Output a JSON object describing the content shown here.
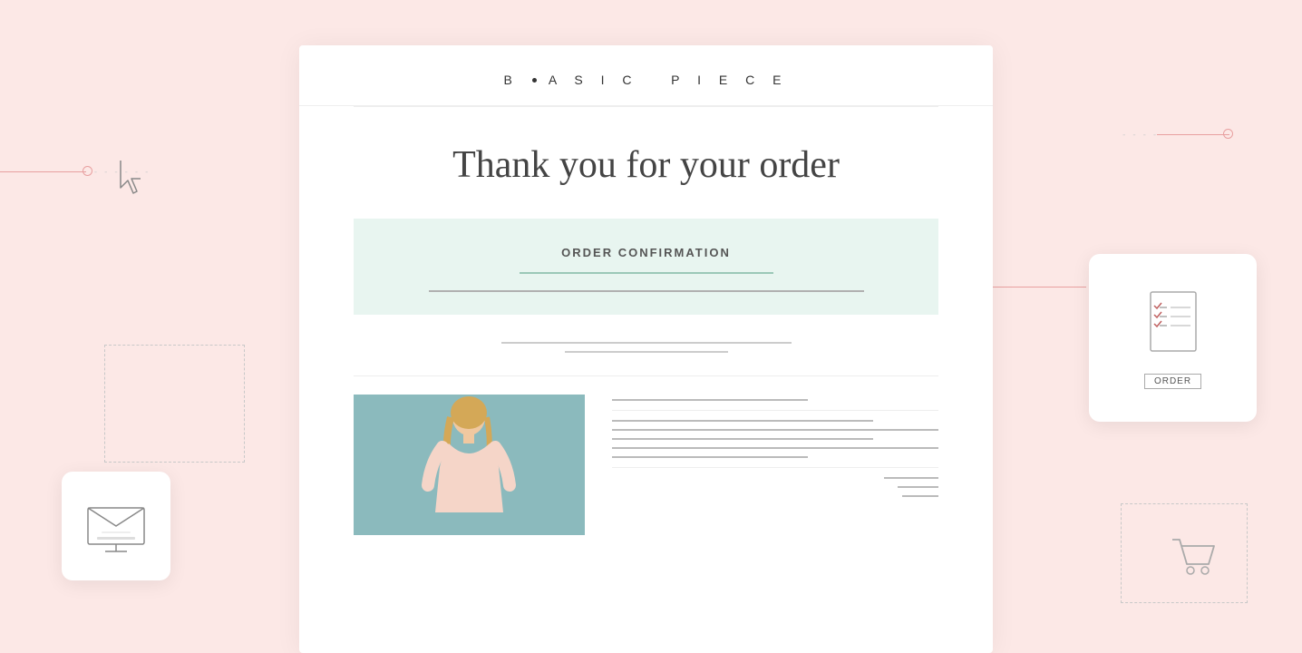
{
  "brand": {
    "name_parts": [
      "B",
      "A",
      "S",
      "I",
      "C",
      "P",
      "I",
      "E",
      "C",
      "E"
    ],
    "display": "B·ASIC  PIECE"
  },
  "email_template": {
    "title": "Thank you for your order",
    "confirmation_label": "ORDER CONFIRMATION",
    "order_button": "ORDER"
  },
  "decorations": {
    "cursor_unicode": "↖",
    "arrow_unicode": "←",
    "cart_unicode": "🛒"
  }
}
